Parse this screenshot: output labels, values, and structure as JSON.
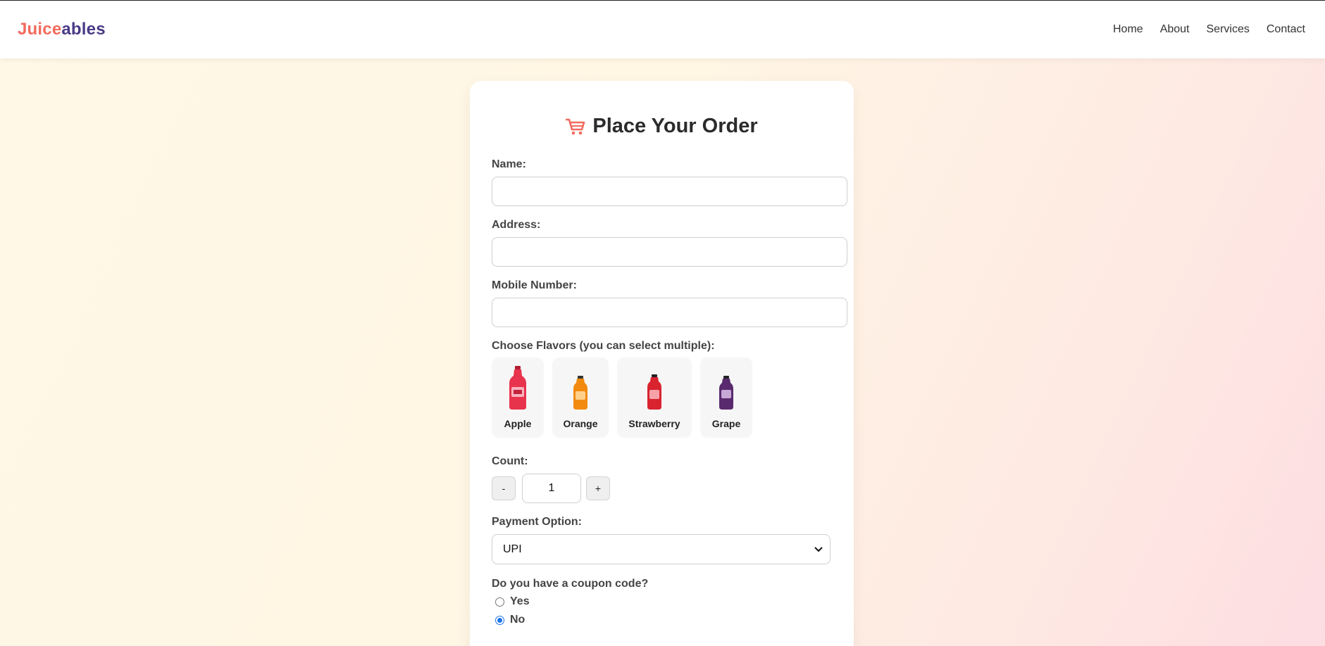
{
  "brand": {
    "part1": "Juice",
    "part2": "ables"
  },
  "nav": {
    "items": [
      "Home",
      "About",
      "Services",
      "Contact"
    ]
  },
  "order": {
    "title": "Place Your Order",
    "name_label": "Name:",
    "address_label": "Address:",
    "mobile_label": "Mobile Number:",
    "flavors_label": "Choose Flavors (you can select multiple):",
    "flavors": [
      {
        "name": "Apple",
        "color": "#e8334d"
      },
      {
        "name": "Orange",
        "color": "#f28a10"
      },
      {
        "name": "Strawberry",
        "color": "#d9232f"
      },
      {
        "name": "Grape",
        "color": "#5a2a6e"
      }
    ],
    "count_label": "Count:",
    "count_value": "1",
    "decrement_label": "-",
    "increment_label": "+",
    "payment_label": "Payment Option:",
    "payment_selected": "UPI",
    "coupon_label": "Do you have a coupon code?",
    "coupon_options": [
      "Yes",
      "No"
    ],
    "coupon_selected": "No"
  },
  "colors": {
    "brand_coral": "#f26b5e",
    "brand_purple": "#4a3a86",
    "radio_blue": "#1a73e8"
  }
}
